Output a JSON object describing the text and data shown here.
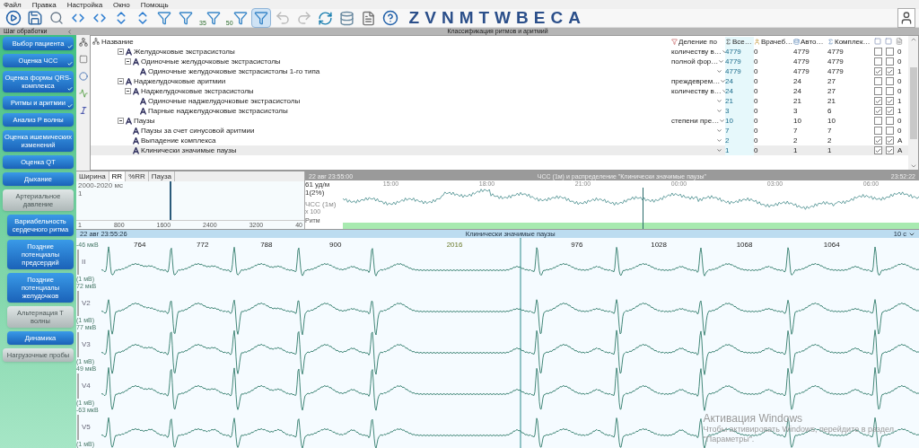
{
  "menu": [
    "Файл",
    "Правка",
    "Настройка",
    "Окно",
    "Помощь"
  ],
  "toolbar": {
    "filters": [
      {
        "badge": "35",
        "selected": false
      },
      {
        "badge": "50",
        "selected": false
      },
      {
        "selected": true
      }
    ],
    "letters": [
      "Z",
      "V",
      "N",
      "M",
      "T",
      "W",
      "B",
      "E",
      "C",
      "A"
    ]
  },
  "step_panel": {
    "title": "Шаг обработки"
  },
  "steps": [
    {
      "label": "Выбор пациента",
      "kind": "step",
      "disabled": false,
      "checked": true
    },
    {
      "label": "Оценка ЧСС",
      "kind": "step",
      "disabled": false,
      "checked": true
    },
    {
      "label": "Оценка формы QRS-комплекса",
      "kind": "step",
      "disabled": false,
      "checked": true
    },
    {
      "label": "Ритмы и аритмии",
      "kind": "step",
      "disabled": false,
      "checked": true
    },
    {
      "label": "Анализ P волны",
      "kind": "step",
      "disabled": false,
      "checked": false
    },
    {
      "label": "Оценка ишемических изменений",
      "kind": "step",
      "disabled": false,
      "checked": false
    },
    {
      "label": "Оценка QT",
      "kind": "step",
      "disabled": false,
      "checked": false
    },
    {
      "label": "Дыхание",
      "kind": "step",
      "disabled": false,
      "checked": false
    },
    {
      "label": "Артериальное давление",
      "kind": "step",
      "disabled": true,
      "checked": false
    },
    {
      "label": "Вариабельность сердечного ритма",
      "kind": "substep",
      "disabled": false,
      "checked": false
    },
    {
      "label": "Поздние потенциалы предсердий",
      "kind": "substep",
      "disabled": false,
      "checked": false
    },
    {
      "label": "Поздние потенциалы желудочков",
      "kind": "substep",
      "disabled": false,
      "checked": false
    },
    {
      "label": "Альтернация T волны",
      "kind": "substep",
      "disabled": true,
      "checked": false
    },
    {
      "label": "Динамика",
      "kind": "substep",
      "disabled": false,
      "checked": false
    },
    {
      "label": "Нагрузочные пробы",
      "kind": "step",
      "disabled": true,
      "checked": false
    }
  ],
  "classification": {
    "title": "Классификация ритмов и аритмий",
    "columns": [
      "Название",
      "Деление по",
      "Все…",
      "Врачеб…",
      "Авто…",
      "Комплек…"
    ],
    "rows": [
      {
        "name": "Желудочковые экстрасистолы",
        "division": "количеству в…",
        "all": "4779",
        "doctor": "0",
        "auto": "4779",
        "complexes": "4779",
        "check_a": false,
        "check_b": false,
        "flag": "0",
        "selected": false,
        "expanded": true,
        "children": [
          {
            "name": "Одиночные желудочковые экстрасистолы",
            "division": "полной фор…",
            "all": "4779",
            "doctor": "0",
            "auto": "4779",
            "complexes": "4779",
            "check_a": false,
            "check_b": false,
            "flag": "0",
            "selected": false,
            "expanded": true,
            "children": [
              {
                "name": "Одиночные желудочковые экстрасистолы 1-го типа",
                "all": "4779",
                "doctor": "0",
                "auto": "4779",
                "complexes": "4779",
                "check_a": true,
                "check_b": true,
                "flag": "1",
                "selected": false
              }
            ]
          }
        ]
      },
      {
        "name": "Наджелудочковые аритмии",
        "division": "преждеврем…",
        "all": "24",
        "doctor": "0",
        "auto": "24",
        "complexes": "27",
        "check_a": false,
        "check_b": false,
        "flag": "0",
        "selected": false,
        "expanded": true,
        "children": [
          {
            "name": "Наджелудочковые экстрасистолы",
            "division": "количеству в…",
            "all": "24",
            "doctor": "0",
            "auto": "24",
            "complexes": "27",
            "check_a": false,
            "check_b": false,
            "flag": "0",
            "selected": false,
            "expanded": true,
            "children": [
              {
                "name": "Одиночные наджелудочковые экстрасистолы",
                "all": "21",
                "doctor": "0",
                "auto": "21",
                "complexes": "21",
                "check_a": true,
                "check_b": true,
                "flag": "1",
                "selected": false
              },
              {
                "name": "Парные наджелудочковые экстрасистолы",
                "all": "3",
                "doctor": "0",
                "auto": "3",
                "complexes": "6",
                "check_a": true,
                "check_b": true,
                "flag": "1",
                "selected": false
              }
            ]
          }
        ]
      },
      {
        "name": "Паузы",
        "division": "степени пре…",
        "all": "10",
        "doctor": "0",
        "auto": "10",
        "complexes": "10",
        "check_a": false,
        "check_b": false,
        "flag": "0",
        "selected": false,
        "expanded": true,
        "children": [
          {
            "name": "Паузы за счет синусовой аритмии",
            "all": "7",
            "doctor": "0",
            "auto": "7",
            "complexes": "7",
            "check_a": false,
            "check_b": false,
            "flag": "0",
            "selected": false
          },
          {
            "name": "Выпадение комплекса",
            "all": "2",
            "doctor": "0",
            "auto": "2",
            "complexes": "2",
            "check_a": true,
            "check_b": true,
            "flag": "A",
            "selected": false
          },
          {
            "name": "Клинически значимые паузы",
            "all": "1",
            "doctor": "0",
            "auto": "1",
            "complexes": "1",
            "check_a": true,
            "check_b": true,
            "flag": "A",
            "selected": true
          }
        ]
      }
    ]
  },
  "histogram": {
    "tabs": [
      {
        "label": "Ширина",
        "selected": false
      },
      {
        "label": "RR",
        "selected": true
      },
      {
        "label": "%RR",
        "selected": false
      },
      {
        "label": "Пауза",
        "selected": false
      }
    ],
    "range": "2000-2020 мс",
    "count": "1",
    "axis": [
      "1",
      "800",
      "1600",
      "2400",
      "3200",
      "40"
    ]
  },
  "trend": {
    "start": "22 авг 23:55:00",
    "title": "ЧСС (1м) и распределение \"Клинически значимые паузы\"",
    "end": "23:52:22",
    "rate": "61 уд/м",
    "share": "1(2%)",
    "series": "ЧСС (1м)",
    "factor": "x 100",
    "rhythm_label": "Ритм",
    "times": [
      "15:00",
      "18:00",
      "21:00",
      "00:00",
      "03:00",
      "06:00"
    ]
  },
  "ecg": {
    "time": "22 авг 23:55:26",
    "title": "Клинически значимые паузы",
    "scale": "10 с",
    "rr": [
      "764",
      "772",
      "788",
      "900",
      "2016",
      "976",
      "1028",
      "1068",
      "1064"
    ],
    "leads": [
      {
        "amplitude": "-46 мкВ",
        "name": "II",
        "calibration": "(1 мВ)"
      },
      {
        "amplitude": "72 мкВ",
        "name": "V2",
        "calibration": "(1 мВ)"
      },
      {
        "amplitude": "77 мкВ",
        "name": "V3",
        "calibration": "(1 мВ)"
      },
      {
        "amplitude": "49 мкВ",
        "name": "V4",
        "calibration": "(1 мВ)"
      },
      {
        "amplitude": "-63 мкВ",
        "name": "V5",
        "calibration": "(1 мВ)"
      }
    ]
  },
  "activation": {
    "title": "Активация Windows",
    "text": "Чтобы активировать Windows, перейдите в раздел",
    "link": "\"Параметры\"."
  }
}
